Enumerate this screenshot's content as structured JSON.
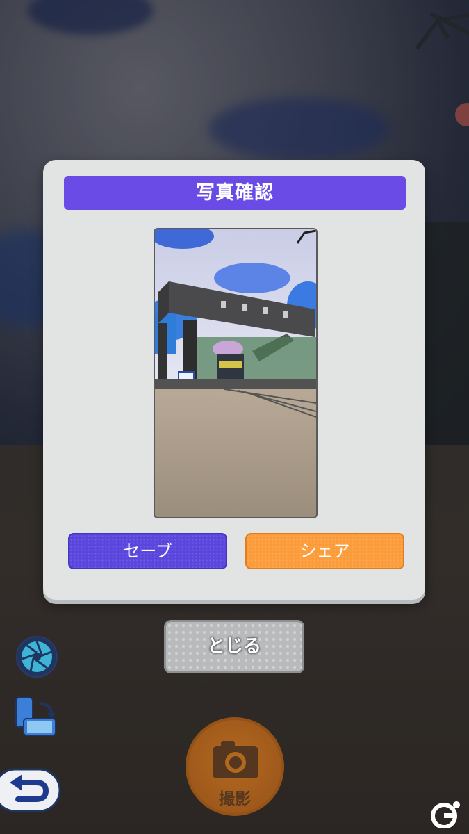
{
  "modal": {
    "title": "写真確認",
    "save_label": "セーブ",
    "share_label": "シェア"
  },
  "close_label": "とじる",
  "shutter_label": "撮影",
  "icons": {
    "aperture": "camera-aperture-icon",
    "rotate": "rotate-device-icon",
    "back": "back-arrow-icon",
    "camera": "camera-icon",
    "logo": "site-logo-icon"
  },
  "colors": {
    "title_bg": "#6a4be6",
    "save_bg": "#5a45dd",
    "share_bg": "#fb9b3a",
    "close_bg": "#b9babb",
    "shutter_bg": "#c9741e"
  }
}
